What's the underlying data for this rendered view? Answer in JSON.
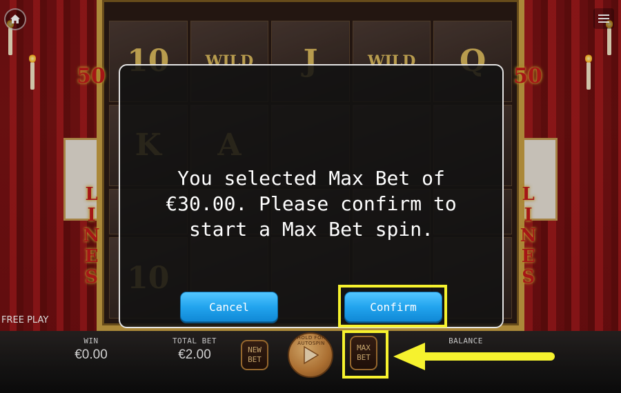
{
  "game": {
    "paylines_number": "50",
    "paylines_word": "LINES",
    "reel_symbols": [
      "10",
      "WILD",
      "J",
      "WILD",
      "Q",
      "K",
      "A",
      "",
      "",
      "",
      "",
      "",
      "",
      "",
      "",
      "10",
      "",
      "",
      "",
      ""
    ]
  },
  "dialog": {
    "message": "You selected Max Bet of €30.00. Please confirm to start a Max Bet spin.",
    "cancel_label": "Cancel",
    "confirm_label": "Confirm"
  },
  "bottom_bar": {
    "free_play_label": "FREE PLAY",
    "win_label": "WIN",
    "win_value": "€0.00",
    "total_bet_label": "TOTAL BET",
    "total_bet_value": "€2.00",
    "new_bet_label": "NEW\nBET",
    "spin_hint": "HOLD FOR AUTOSPIN",
    "max_bet_label": "MAX\nBET",
    "balance_label": "BALANCE",
    "balance_value": ""
  },
  "colors": {
    "button_blue": "#22a4ee",
    "highlight_yellow": "#f6f22e",
    "frame_gold": "#c9a044"
  },
  "icons": {
    "home": "home-icon",
    "menu": "hamburger-menu-icon",
    "spin": "play-triangle-icon",
    "annotation": "arrow-left-icon"
  }
}
